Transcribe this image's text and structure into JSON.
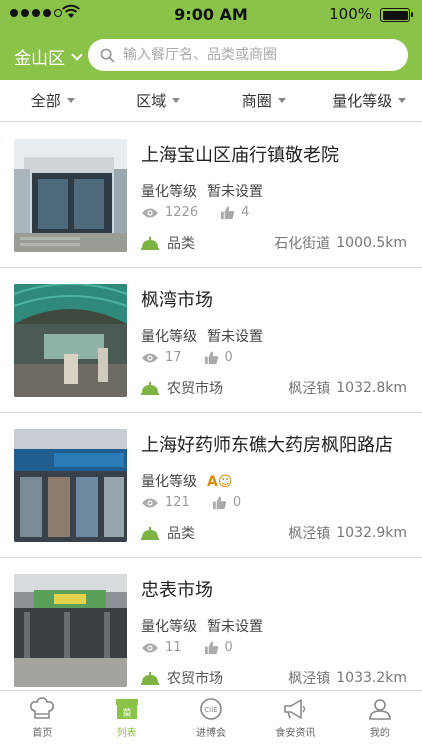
{
  "status_bar": {
    "time": "9:00 AM",
    "battery": "100%"
  },
  "header": {
    "city": "金山区",
    "search_placeholder": "输入餐厅名、品类或商圈"
  },
  "filters": [
    "全部",
    "区域",
    "商圈",
    "量化等级"
  ],
  "list": {
    "grade_label": "量化等级",
    "items": [
      {
        "name": "上海宝山区庙行镇敬老院",
        "grade": "暂未设置",
        "grade_badge": "",
        "views": "1226",
        "likes": "4",
        "category": "品类",
        "location": "石化街道",
        "distance": "1000.5km"
      },
      {
        "name": "枫湾市场",
        "grade": "暂未设置",
        "grade_badge": "",
        "views": "17",
        "likes": "0",
        "category": "农贸市场",
        "location": "枫泾镇",
        "distance": "1032.8km"
      },
      {
        "name": "上海好药师东礁大药房枫阳路店",
        "grade": "",
        "grade_badge": "A☺",
        "views": "121",
        "likes": "0",
        "category": "品类",
        "location": "枫泾镇",
        "distance": "1032.9km"
      },
      {
        "name": "忠表市场",
        "grade": "暂未设置",
        "grade_badge": "",
        "views": "11",
        "likes": "0",
        "category": "农贸市场",
        "location": "枫泾镇",
        "distance": "1033.2km"
      }
    ]
  },
  "tabbar": {
    "active_color": "#8bc34a",
    "tabs": [
      "首页",
      "列表",
      "进博会",
      "食安资讯",
      "我的"
    ]
  }
}
